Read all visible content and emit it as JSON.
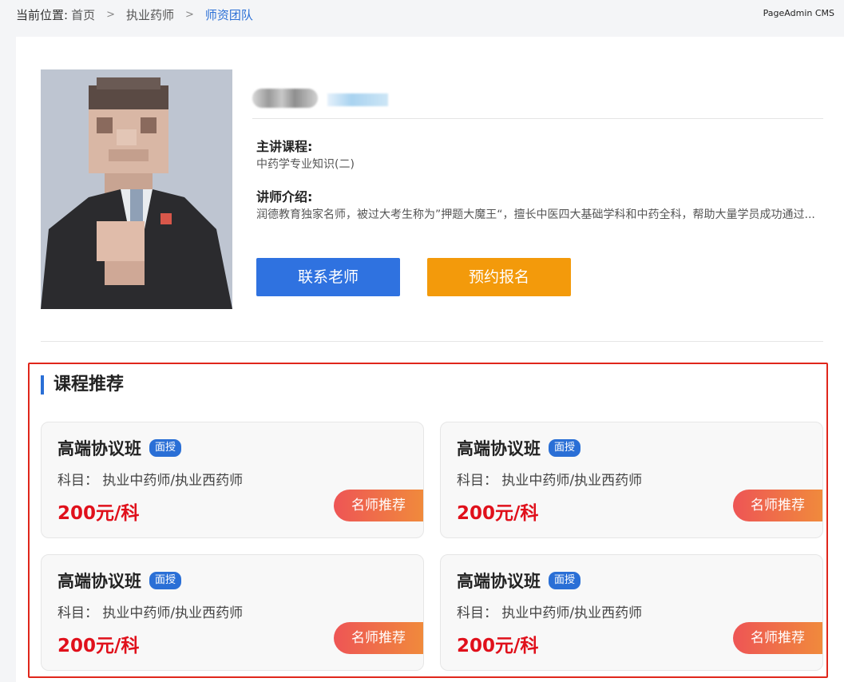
{
  "breadcrumb": {
    "prefix": "当前位置:",
    "items": [
      "首页",
      "执业药师",
      "师资团队"
    ],
    "separator": ">"
  },
  "brand": "PageAdmin CMS",
  "teacher": {
    "course_label": "主讲课程:",
    "course_value": "中药学专业知识(二)",
    "intro_label": "讲师介绍:",
    "intro_value": "润德教育独家名师，被过大考生称为”押题大魔王“，擅长中医四大基础学科和中药全科，帮助大量学员成功通过..."
  },
  "buttons": {
    "contact": "联系老师",
    "enroll": "预约报名"
  },
  "recommend": {
    "title": "课程推荐",
    "cards": [
      {
        "title": "高端协议班",
        "badge": "面授",
        "subject": "科目： 执业中药师/执业西药师",
        "price": "200元/科",
        "tag": "名师推荐"
      },
      {
        "title": "高端协议班",
        "badge": "面授",
        "subject": "科目： 执业中药师/执业西药师",
        "price": "200元/科",
        "tag": "名师推荐"
      },
      {
        "title": "高端协议班",
        "badge": "面授",
        "subject": "科目： 执业中药师/执业西药师",
        "price": "200元/科",
        "tag": "名师推荐"
      },
      {
        "title": "高端协议班",
        "badge": "面授",
        "subject": "科目： 执业中药师/执业西药师",
        "price": "200元/科",
        "tag": "名师推荐"
      }
    ]
  },
  "colors": {
    "accent_blue": "#2f72e0",
    "accent_orange": "#f39a0b",
    "price_red": "#e0101b",
    "highlight_border": "#e0261b"
  }
}
